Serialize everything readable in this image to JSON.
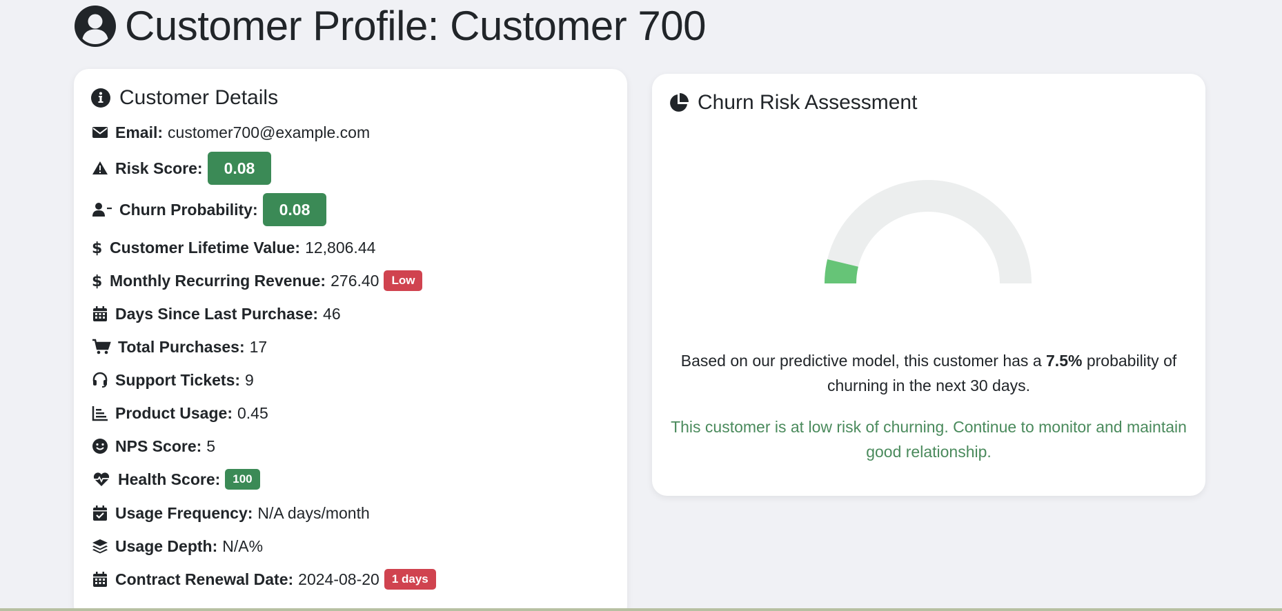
{
  "page": {
    "title": "Customer Profile: Customer 700",
    "title_icon": "user-circle-icon"
  },
  "details": {
    "header": "Customer Details",
    "header_icon": "info-circle-icon",
    "email": {
      "label": "Email:",
      "value": "customer700@example.com",
      "icon": "envelope-icon"
    },
    "risk_score": {
      "label": "Risk Score:",
      "value": "0.08",
      "icon": "warning-icon"
    },
    "churn_probability": {
      "label": "Churn Probability:",
      "value": "0.08",
      "icon": "user-minus-icon"
    },
    "clv": {
      "label": "Customer Lifetime Value:",
      "value": "12,806.44",
      "icon": "dollar-icon"
    },
    "mrr": {
      "label": "Monthly Recurring Revenue:",
      "value": "276.40",
      "badge": "Low",
      "icon": "dollar-icon"
    },
    "days_since_purchase": {
      "label": "Days Since Last Purchase:",
      "value": "46",
      "icon": "calendar-icon"
    },
    "total_purchases": {
      "label": "Total Purchases:",
      "value": "17",
      "icon": "cart-icon"
    },
    "support_tickets": {
      "label": "Support Tickets:",
      "value": "9",
      "icon": "headset-icon"
    },
    "product_usage": {
      "label": "Product Usage:",
      "value": "0.45",
      "icon": "chart-bar-icon"
    },
    "nps_score": {
      "label": "NPS Score:",
      "value": "5",
      "icon": "smile-icon"
    },
    "health_score": {
      "label": "Health Score:",
      "value": "100",
      "icon": "heartbeat-icon"
    },
    "usage_frequency": {
      "label": "Usage Frequency:",
      "value": "N/A days/month",
      "icon": "calendar-check-icon"
    },
    "usage_depth": {
      "label": "Usage Depth:",
      "value": "N/A%",
      "icon": "layers-icon"
    },
    "renewal_date": {
      "label": "Contract Renewal Date:",
      "value": "2024-08-20",
      "badge": "1 days",
      "icon": "calendar-icon"
    }
  },
  "churn": {
    "header": "Churn Risk Assessment",
    "header_icon": "pie-chart-icon",
    "text_prefix": "Based on our predictive model, this customer has a ",
    "probability": "7.5%",
    "text_suffix": " probability of churning in the next 30 days.",
    "advice": "This customer is at low risk of churning. Continue to monitor and maintain good relationship.",
    "gauge_fraction": 0.075
  },
  "colors": {
    "success": "#3b8a56",
    "danger": "#d0434f",
    "gauge_fill": "#66c477",
    "gauge_track": "#eceeee",
    "advice_text": "#4a8a5c"
  }
}
